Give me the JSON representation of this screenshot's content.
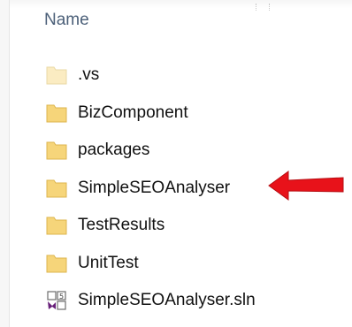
{
  "column_header": {
    "label": "Name"
  },
  "items": [
    {
      "name": ".vs",
      "type": "folder",
      "icon": "folder-icon-hidden"
    },
    {
      "name": "BizComponent",
      "type": "folder",
      "icon": "folder-icon"
    },
    {
      "name": "packages",
      "type": "folder",
      "icon": "folder-icon"
    },
    {
      "name": "SimpleSEOAnalyser",
      "type": "folder",
      "icon": "folder-icon",
      "highlighted": true
    },
    {
      "name": "TestResults",
      "type": "folder",
      "icon": "folder-icon"
    },
    {
      "name": "UnitTest",
      "type": "folder",
      "icon": "folder-icon"
    },
    {
      "name": "SimpleSEOAnalyser.sln",
      "type": "solution-file",
      "icon": "visual-studio-solution-icon"
    }
  ],
  "annotation": {
    "icon": "red-arrow-icon",
    "color": "#e8121a",
    "points_to": "SimpleSEOAnalyser"
  },
  "colors": {
    "folder": "#f6d57a",
    "folder_hidden": "#fbecc2",
    "header_text": "#4c6079"
  }
}
